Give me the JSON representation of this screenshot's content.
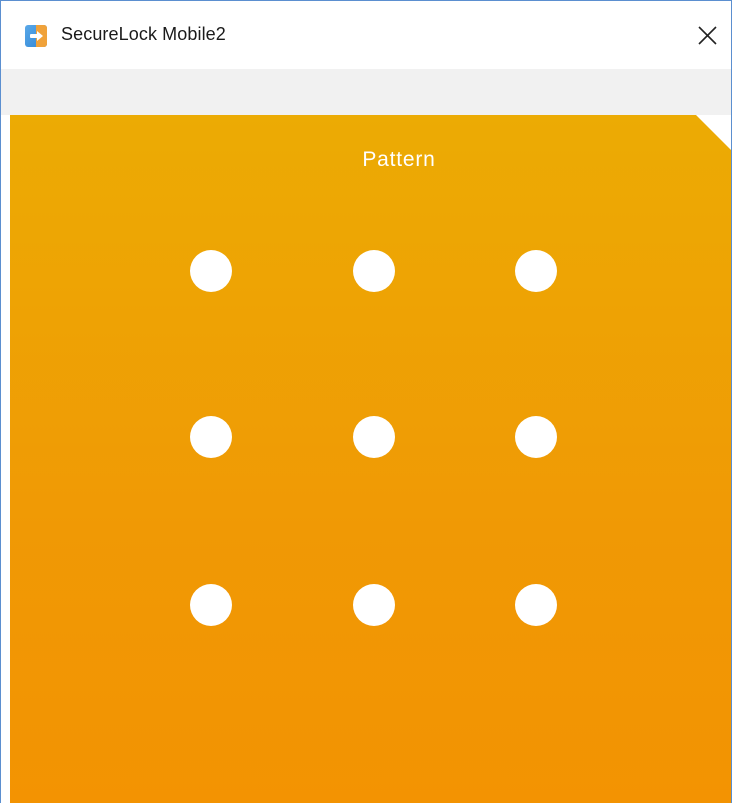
{
  "window": {
    "title": "SecureLock Mobile2",
    "icon": "securelock-app-icon",
    "close_icon": "close-icon"
  },
  "panel": {
    "title": "Pattern",
    "accent_top": "#ecab04",
    "accent_bottom": "#f39302"
  },
  "pattern_grid": {
    "rows": 3,
    "cols": 3,
    "dots": [
      {
        "id": 1
      },
      {
        "id": 2
      },
      {
        "id": 3
      },
      {
        "id": 4
      },
      {
        "id": 5
      },
      {
        "id": 6
      },
      {
        "id": 7
      },
      {
        "id": 8
      },
      {
        "id": 9
      }
    ]
  }
}
